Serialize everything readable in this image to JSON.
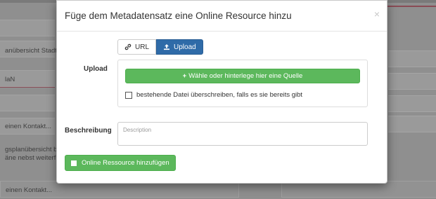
{
  "modal": {
    "title": "Füge dem Metadatensatz eine Online Resource hinzu",
    "close_glyph": "×",
    "tabs": [
      {
        "label": "URL",
        "icon": "link-icon",
        "active": false
      },
      {
        "label": "Upload",
        "icon": "upload-icon",
        "active": true
      }
    ],
    "upload_label": "Upload",
    "choose_button": {
      "icon_glyph": "+",
      "label": "Wähle oder hinterlege hier eine Quelle"
    },
    "overwrite_checkbox": {
      "label": "bestehende Datei überschreiben, falls es sie bereits gibt",
      "checked": false
    },
    "description_label": "Beschreibung",
    "description_placeholder": "Description",
    "description_value": "",
    "submit_button": {
      "label": "Online Ressource hinzufügen",
      "icon": "square-icon"
    }
  },
  "background": {
    "rows": [
      "anübersicht Stadt",
      "laN",
      "einen Kontakt...",
      "gsplanübersicht b",
      "äne nebst weiterf",
      "einen Kontakt..."
    ]
  },
  "colors": {
    "primary": "#2f6ba8",
    "success": "#5cb85c",
    "overlay": "#8f8f8f"
  }
}
